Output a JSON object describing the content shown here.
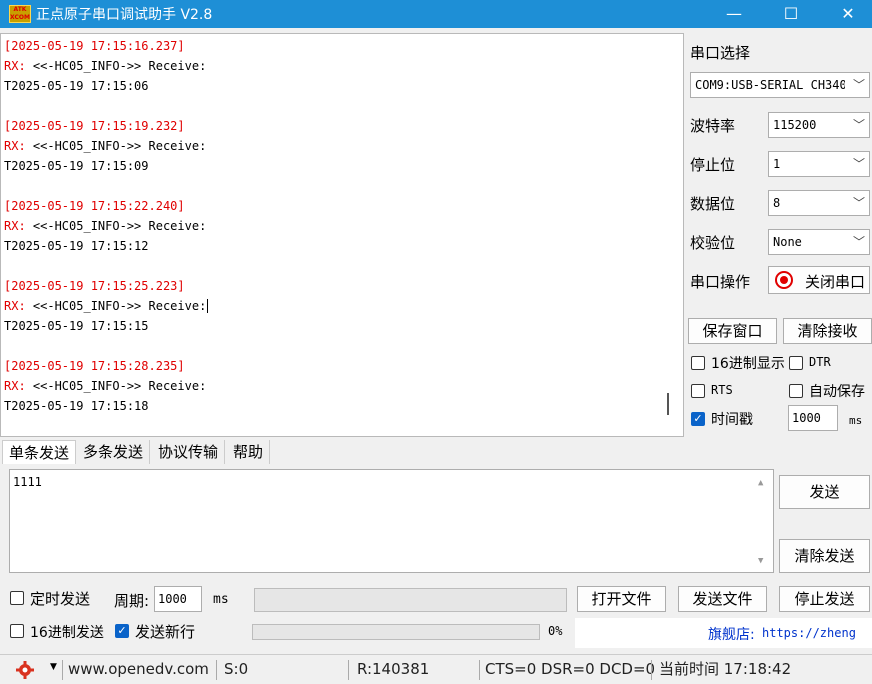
{
  "window": {
    "title": "正点原子串口调试助手 V2.8",
    "icon_text": "ATK XCOM",
    "minimize": "—",
    "maximize": "☐",
    "close": "✕"
  },
  "receive": {
    "entries": [
      {
        "timestamp": "[2025-05-19 17:15:16.237]",
        "rx": "RX:",
        "message": " <<-HC05_INFO->> Receive:",
        "payload": "T2025-05-19 17:15:06"
      },
      {
        "timestamp": "[2025-05-19 17:15:19.232]",
        "rx": "RX:",
        "message": " <<-HC05_INFO->> Receive:",
        "payload": "T2025-05-19 17:15:09"
      },
      {
        "timestamp": "[2025-05-19 17:15:22.240]",
        "rx": "RX:",
        "message": " <<-HC05_INFO->> Receive:",
        "payload": "T2025-05-19 17:15:12"
      },
      {
        "timestamp": "[2025-05-19 17:15:25.223]",
        "rx": "RX:",
        "message": " <<-HC05_INFO->> Receive:",
        "payload": "T2025-05-19 17:15:15"
      },
      {
        "timestamp": "[2025-05-19 17:15:28.235]",
        "rx": "RX:",
        "message": " <<-HC05_INFO->> Receive:",
        "payload": "T2025-05-19 17:15:18"
      }
    ]
  },
  "settings": {
    "port_label": "串口选择",
    "port_value": "COM9:USB-SERIAL CH340",
    "baud_label": "波特率",
    "baud_value": "115200",
    "stop_label": "停止位",
    "stop_value": "1",
    "data_label": "数据位",
    "data_value": "8",
    "parity_label": "校验位",
    "parity_value": "None",
    "op_label": "串口操作",
    "op_button": "关闭串口",
    "save_window": "保存窗口",
    "clear_receive": "清除接收",
    "hex_display": "16进制显示",
    "dtr": "DTR",
    "rts": "RTS",
    "auto_save": "自动保存",
    "timestamp": "时间戳",
    "timestamp_value": "1000",
    "timestamp_unit": "ms",
    "timestamp_checked": true
  },
  "tabs": [
    "单条发送",
    "多条发送",
    "协议传输",
    "帮助"
  ],
  "send": {
    "text": "1111",
    "send_button": "发送",
    "clear_send": "清除发送",
    "timed_send": "定时发送",
    "period_label": "周期:",
    "period_value": "1000",
    "period_unit": "ms",
    "open_file": "打开文件",
    "send_file": "发送文件",
    "stop_send": "停止发送",
    "hex_send": "16进制发送",
    "send_newline": "发送新行",
    "newline_checked": true,
    "progress_percent": "0%",
    "progress": 0,
    "store_label": "旗舰店:",
    "store_link": "https://zheng"
  },
  "status": {
    "website": "www.openedv.com",
    "sent": "S:0",
    "received": "R:140381",
    "lines": "CTS=0 DSR=0 DCD=0",
    "time": "当前时间 17:18:42"
  },
  "colors": {
    "titlebar": "#1e8fd6",
    "timestamp": "#e00000",
    "checkbox": "#0a63c9"
  }
}
